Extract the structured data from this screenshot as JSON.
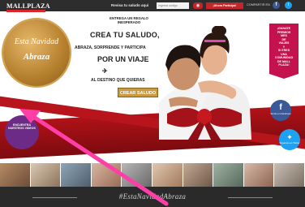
{
  "header": {
    "logo_text": "MALLPLAZA",
    "caption": "Revisa tu saludo aqui",
    "code_placeholder": "Ingresa codigo",
    "eye_glyph": "◉",
    "participate_label": "¡Ahora Participa!",
    "share_label": "COMPARTIR EN",
    "facebook_glyph": "f",
    "twitter_glyph": "t"
  },
  "badge": {
    "line1": "Esta Navidad",
    "line2": "Abraza"
  },
  "headline": {
    "line1": "ENTREGA UN REGALO INESPERADO",
    "line2": "CREA TU SALUDO,",
    "line3": "ABRAZA, SORPRENDE Y PARTICIPA",
    "line4": "POR UN VIAJE",
    "line5": "AL DESTINO QUE QUIERAS",
    "cta_label": "CREAR SALUDO"
  },
  "promo": {
    "lines": [
      "¡GANATE",
      "PREMIOS",
      "MES",
      "DE",
      "VIAJES",
      "Y",
      "SI ERES",
      "UNA",
      "COMUNIDAD",
      "DE MALL",
      "PLAZA!"
    ]
  },
  "social": {
    "facebook_label": "Sé fan en Facebook",
    "twitter_label": "Síguenos en Twitter"
  },
  "bubble": {
    "text": "ENCUENTRA NUESTROS VIDEOS"
  },
  "footer": {
    "hashtag": "#EstaNavidadAbraza"
  },
  "colors": {
    "brand_red": "#c0262a",
    "ribbon_red": "#b8141c",
    "gold": "#c99a3e",
    "promo_pink": "#c4124f",
    "facebook_blue": "#3b5998",
    "twitter_blue": "#1da1f2",
    "annotation_arrow": "#ff3ea8"
  }
}
